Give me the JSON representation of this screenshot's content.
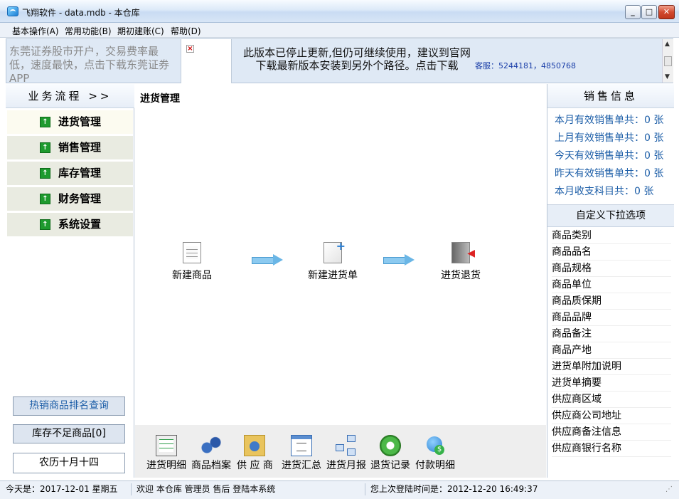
{
  "window": {
    "title": "飞翔软件 - data.mdb - 本仓库"
  },
  "menu": [
    "基本操作(A)",
    "常用功能(B)",
    "期初建账(C)",
    "帮助(D)"
  ],
  "banner": {
    "ad_left": "东莞证券股市开户，交易费率最低，速度最快，点击下载东莞证券APP",
    "notice": "此版本已停止更新,但仍可继续使用，建议到官网下载最新版本安装到另外个路径。点击下载",
    "contact": "客服：5244181，4850768"
  },
  "sidebar": {
    "header": "业务流程 >>",
    "items": [
      {
        "label": "进货管理",
        "icon": "green-up-arrow-icon",
        "active": true
      },
      {
        "label": "销售管理",
        "icon": "green-up-arrow-icon",
        "active": false
      },
      {
        "label": "库存管理",
        "icon": "green-up-arrow-icon",
        "active": false
      },
      {
        "label": "财务管理",
        "icon": "green-up-arrow-icon",
        "active": false
      },
      {
        "label": "系统设置",
        "icon": "green-up-arrow-icon",
        "active": false
      }
    ],
    "hot_button": "热销商品排名查询",
    "stock_button": "库存不足商品[0]",
    "lunar_date": "农历十月十四"
  },
  "main": {
    "title": "进货管理",
    "flow": [
      "新建商品",
      "新建进货单",
      "进货退货"
    ],
    "toolbar": [
      "进货明细",
      "商品档案",
      "供 应 商",
      "进货汇总",
      "进货月报",
      "退货记录",
      "付款明细"
    ]
  },
  "sales_info": {
    "header": "销售信息",
    "stats": [
      "本月有效销售单共：0 张",
      "上月有效销售单共：0 张",
      "今天有效销售单共：0 张",
      "昨天有效销售单共：0 张",
      "本月收支科目共：0 张"
    ]
  },
  "custom_options": {
    "header": "自定义下拉选项",
    "items": [
      "商品类别",
      "商品品名",
      "商品规格",
      "商品单位",
      "商品质保期",
      "商品品牌",
      "商品备注",
      "商品产地",
      "进货单附加说明",
      "进货单摘要",
      "供应商区域",
      "供应商公司地址",
      "供应商备注信息",
      "供应商银行名称"
    ]
  },
  "status": {
    "today": "今天是：2017-12-01  星期五",
    "welcome": "欢迎 本仓库 管理员 售后 登陆本系统",
    "last_login": "您上次登陆时间是：2012-12-20 16:49:37"
  }
}
